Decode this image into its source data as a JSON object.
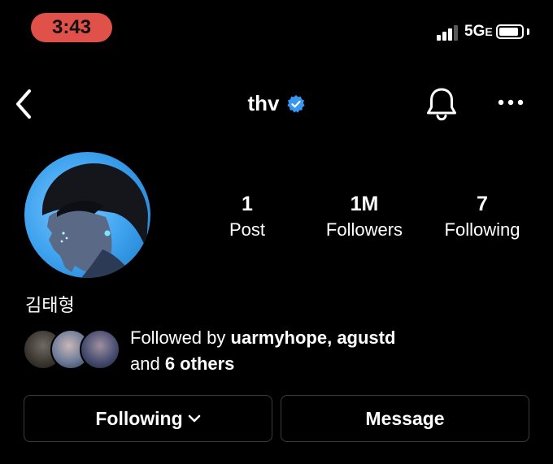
{
  "status_bar": {
    "time": "3:43",
    "network_main": "5G",
    "network_suffix": "E",
    "signal_level": 0.75,
    "battery_level": 0.9
  },
  "header": {
    "username": "thv",
    "verified": true,
    "icons": [
      "back-arrow-icon",
      "verified-badge-icon",
      "bell-icon",
      "more-icon"
    ]
  },
  "profile": {
    "stats": [
      {
        "value": "1",
        "label": "Post"
      },
      {
        "value": "1M",
        "label": "Followers"
      },
      {
        "value": "7",
        "label": "Following"
      }
    ],
    "display_name": "김태형"
  },
  "followed_by": {
    "prefix": "Followed by ",
    "names": "uarmyhope, agustd",
    "and": "and ",
    "others": "6 others"
  },
  "actions": {
    "following_label": "Following",
    "message_label": "Message"
  },
  "colors": {
    "time_pill": "#e0514a",
    "verified": "#3897f0",
    "button_border": "#3b3b3b"
  }
}
